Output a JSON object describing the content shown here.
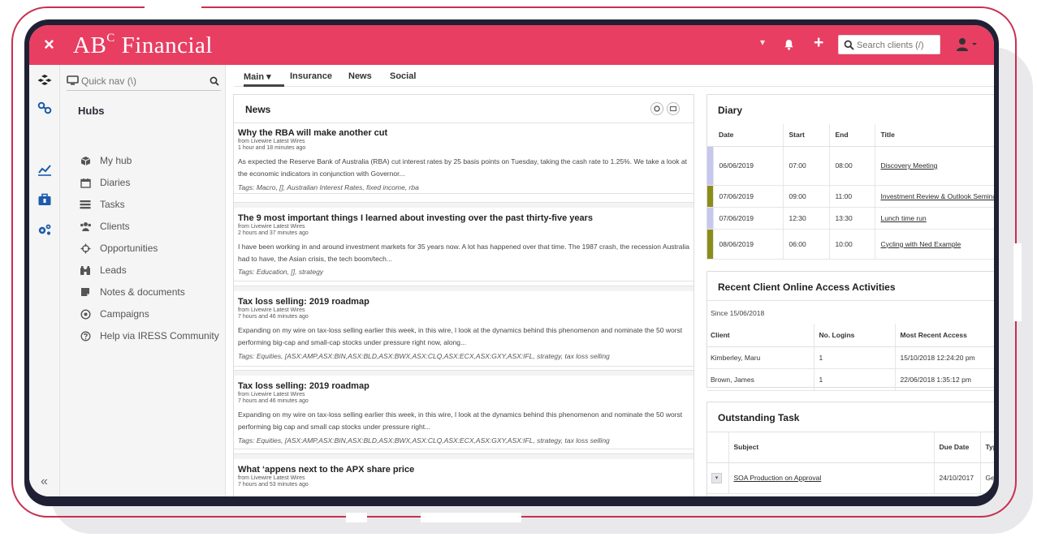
{
  "app": {
    "close_glyph": "×",
    "brand_text": "AB",
    "brand_sup": "C",
    "brand_rest": " Financial"
  },
  "topbar": {
    "caret": "▾",
    "plus": "+",
    "search_placeholder": "Search clients (/)"
  },
  "icons": [
    "layers-icon",
    "link-icon",
    "trend-chart-icon",
    "briefcase-icon",
    "cogs-icon",
    "monitor-icon",
    "search-icon",
    "bell-icon",
    "user-icon"
  ],
  "sidebar": {
    "quicknav_placeholder": "Quick nav (\\)",
    "hubs_title": "Hubs",
    "collapse": "«",
    "items": [
      {
        "label": "My hub",
        "icon": "cube-icon"
      },
      {
        "label": "Diaries",
        "icon": "calendar-icon"
      },
      {
        "label": "Tasks",
        "icon": "tasks-icon"
      },
      {
        "label": "Clients",
        "icon": "users-icon"
      },
      {
        "label": "Opportunities",
        "icon": "crosshair-icon"
      },
      {
        "label": "Leads",
        "icon": "binoculars-icon"
      },
      {
        "label": "Notes & documents",
        "icon": "note-icon"
      },
      {
        "label": "Campaigns",
        "icon": "target-icon"
      },
      {
        "label": "Help via IRESS Community",
        "icon": "help-icon"
      }
    ]
  },
  "tabs": [
    {
      "label": "Main ▾"
    },
    {
      "label": "Insurance"
    },
    {
      "label": "News"
    },
    {
      "label": "Social"
    }
  ],
  "news": {
    "title": "News",
    "items": [
      {
        "title": "Why the RBA will make another cut",
        "source": "from Livewire Latest Wires",
        "time": "1 hour and 18 minutes ago",
        "body": "As expected the Reserve Bank of Australia (RBA) cut interest rates by 25 basis points on Tuesday, taking the cash rate to 1.25%. We take a look at the economic indicators in conjunction with Governor...",
        "tags": "Tags: Macro,  [],  Australian Interest Rates,  fixed income,  rba"
      },
      {
        "title": "The 9 most important things I learned about investing over the past thirty-five years",
        "source": "from Livewire Latest Wires",
        "time": "2 hours and 37 minutes ago",
        "body": "I have been working in and around investment markets for 35 years now. A lot has happened over that time. The 1987 crash, the recession Australia had to have, the Asian crisis, the tech boom/tech...",
        "tags": "Tags: Education,  [],  strategy"
      },
      {
        "title": "Tax loss selling: 2019 roadmap",
        "source": "from Livewire Latest Wires",
        "time": "7 hours and 46 minutes ago",
        "body": "Expanding on my wire on tax-loss selling earlier this week, in this wire, I look at the dynamics behind this phenomenon and nominate the 50 worst performing big-cap and small-cap stocks under pressure right now, along...",
        "tags": "Tags: Equities,  [ASX:AMP,ASX:BIN,ASX:BLD,ASX:BWX,ASX:CLQ,ASX:ECX,ASX:GXY,ASX:IFL,  strategy,  tax loss selling"
      },
      {
        "title": "Tax loss selling: 2019 roadmap",
        "source": "from Livewire Latest Wires",
        "time": "7 hours and 46 minutes ago",
        "body": "Expanding on my wire on tax-loss selling earlier this week, in this wire, I look at the dynamics behind this phenomenon and nominate the 50 worst performing big cap and small cap stocks under pressure right...",
        "tags": "Tags: Equities,  [ASX:AMP,ASX:BIN,ASX:BLD,ASX:BWX,ASX:CLQ,ASX:ECX,ASX:GXY,ASX:IFL,  strategy,  tax loss selling"
      },
      {
        "title": "What ‘appens next to the APX share price",
        "source": "from Livewire Latest Wires",
        "time": "7 hours and 53 minutes ago",
        "body": "",
        "tags": ""
      }
    ]
  },
  "diary": {
    "title": "Diary",
    "columns": [
      "Date",
      "Start",
      "End",
      "Title"
    ],
    "rows": [
      {
        "date": "06/06/2019",
        "start": "07:00",
        "end": "08:00",
        "title": "Discovery Meeting",
        "color": "#c7c7f0"
      },
      {
        "date": "07/06/2019",
        "start": "09:00",
        "end": "11:00",
        "title": "Investment Review & Outlook Seminar",
        "color": "#8c8c1a"
      },
      {
        "date": "07/06/2019",
        "start": "12:30",
        "end": "13:30",
        "title": "Lunch time run",
        "color": "#c7c7f0"
      },
      {
        "date": "08/06/2019",
        "start": "06:00",
        "end": "10:00",
        "title": "Cycling with Ned Example",
        "color": "#8c8c1a"
      }
    ]
  },
  "access": {
    "title": "Recent Client Online Access Activities",
    "since": "Since 15/06/2018",
    "columns": [
      "Client",
      "No. Logins",
      "Most Recent Access"
    ],
    "rows": [
      {
        "client": "Kimberley, Maru",
        "logins": "1",
        "recent": "15/10/2018 12:24:20 pm"
      },
      {
        "client": "Brown, James",
        "logins": "1",
        "recent": "22/06/2018 1:35:12 pm"
      }
    ]
  },
  "tasks": {
    "title": "Outstanding Task",
    "columns": [
      "",
      "Subject",
      "Due Date",
      "Typ"
    ],
    "rows": [
      {
        "toggle": "▾",
        "subject": "SOA Production on Approval",
        "due": "24/10/2017",
        "type": "Ge"
      }
    ]
  },
  "colors": {
    "accent": "#e83e62",
    "frame": "#c8304f",
    "device": "#1f2033"
  }
}
